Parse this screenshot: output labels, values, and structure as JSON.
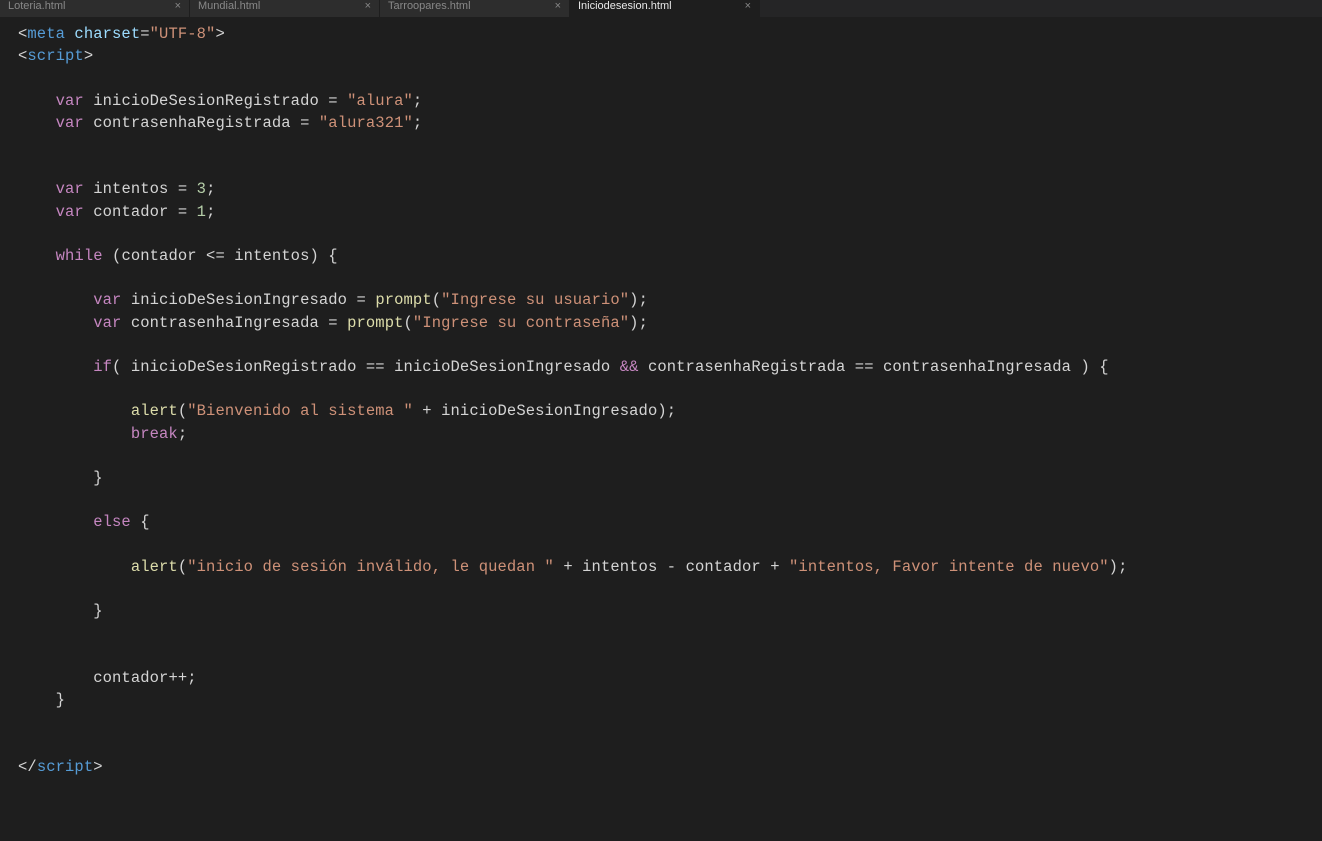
{
  "tabs": [
    {
      "label": "Loteria.html",
      "active": false
    },
    {
      "label": "Mundial.html",
      "active": false
    },
    {
      "label": "Tarroopares.html",
      "active": false
    },
    {
      "label": "Iniciodesesion.html",
      "active": true
    }
  ],
  "code": {
    "meta_tag": "meta",
    "meta_attr": "charset",
    "meta_value": "\"UTF-8\"",
    "script_open": "script",
    "script_close": "script",
    "kw_var": "var",
    "kw_while": "while",
    "kw_if": "if",
    "kw_else": "else",
    "kw_break": "break",
    "id_inicioReg": "inicioDeSesionRegistrado",
    "id_contraReg": "contrasenhaRegistrada",
    "id_intentos": "intentos",
    "id_contador": "contador",
    "id_inicioIng": "inicioDeSesionIngresado",
    "id_contraIng": "contrasenhaIngresada",
    "fn_prompt": "prompt",
    "fn_alert": "alert",
    "str_alura": "\"alura\"",
    "str_alura321": "\"alura321\"",
    "str_ingUsuario": "\"Ingrese su usuario\"",
    "str_ingContra": "\"Ingrese su contraseña\"",
    "str_bienvenido": "\"Bienvenido al sistema \"",
    "str_invalido1": "\"inicio de sesión inválido, le quedan \"",
    "str_invalido2": "\"intentos, Favor intente de nuevo\"",
    "num_3": "3",
    "num_1": "1",
    "op_eq": " = ",
    "op_deq": " == ",
    "op_le": " <= ",
    "op_and": " && ",
    "op_plus": " + ",
    "op_minus": " - ",
    "op_pp": "++",
    "semi": ";",
    "lt": "<",
    "gt": ">",
    "ltc": "</",
    "sp4": "    ",
    "sp8": "        ",
    "sp12": "            ",
    "lp": "(",
    "rp": ")",
    "lb": "{",
    "rb": "}",
    "space": " "
  }
}
